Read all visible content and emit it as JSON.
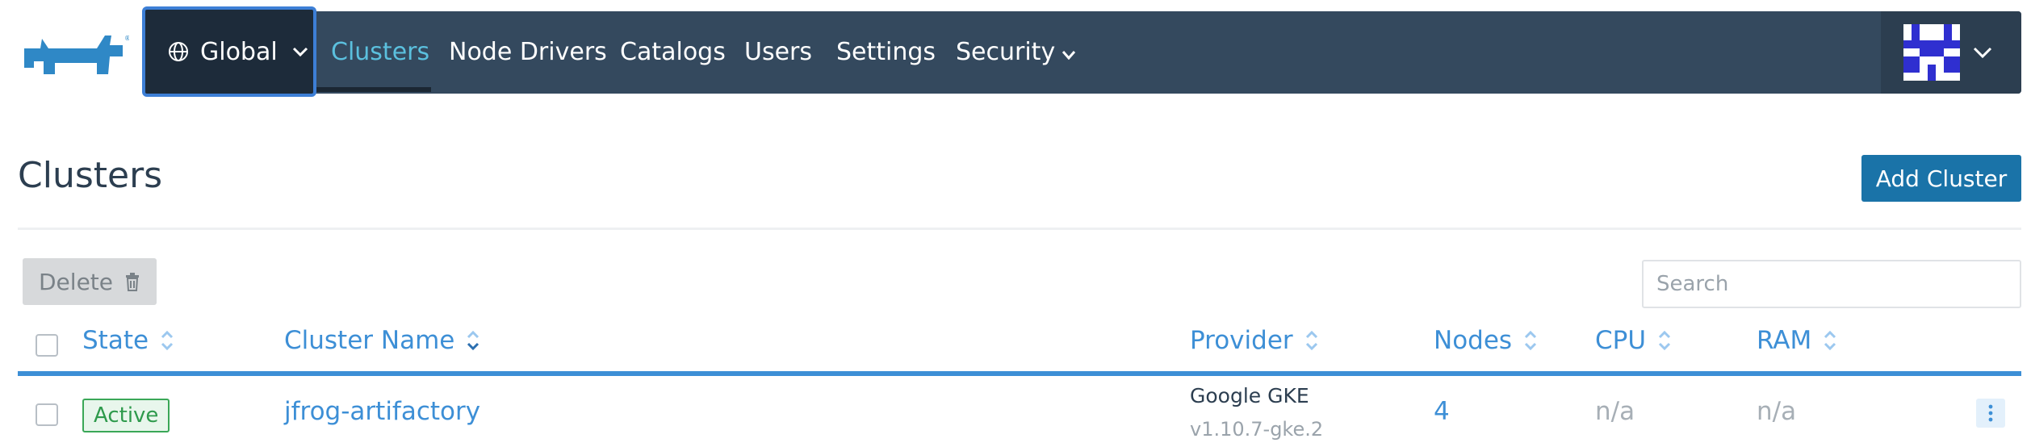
{
  "header": {
    "scope_label": "Global",
    "nav": [
      "Clusters",
      "Node Drivers",
      "Catalogs",
      "Users",
      "Settings",
      "Security"
    ],
    "active": "Clusters"
  },
  "page": {
    "title": "Clusters",
    "add_button": "Add Cluster"
  },
  "toolbar": {
    "delete_label": "Delete",
    "search_placeholder": "Search"
  },
  "table": {
    "columns": [
      "State",
      "Cluster Name",
      "Provider",
      "Nodes",
      "CPU",
      "RAM"
    ],
    "rows": [
      {
        "state": "Active",
        "name": "jfrog-artifactory",
        "provider": "Google GKE",
        "version": "v1.10.7-gke.2",
        "nodes": "4",
        "cpu": "n/a",
        "ram": "n/a"
      }
    ]
  },
  "colors": {
    "nav_bg": "#34495e",
    "accent": "#3d8fd6",
    "primary_button": "#1a73a8",
    "active_green": "#2e9a4c"
  },
  "icons": [
    "rancher-logo",
    "globe-icon",
    "chevron-down-icon",
    "trash-icon",
    "sort-icon",
    "avatar",
    "kebab-menu-icon"
  ]
}
